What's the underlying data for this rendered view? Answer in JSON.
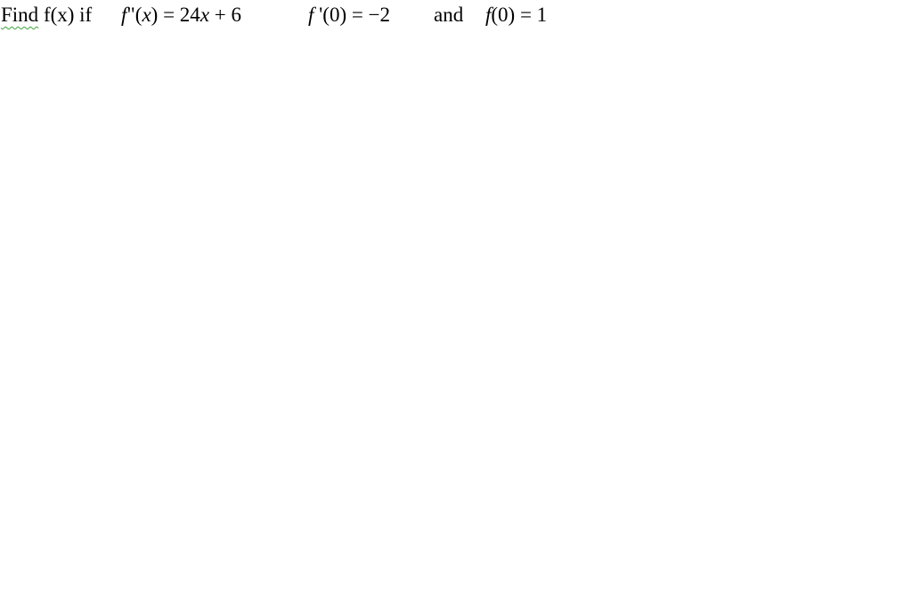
{
  "document": {
    "prefix_word_find": "Find",
    "prefix_rest": " f(x) if",
    "equation_1": {
      "f": "f",
      "primes": "\"",
      "open": "(",
      "var": "x",
      "close_eq": ") = 24",
      "var2": "x",
      "tail": " + 6"
    },
    "equation_2": {
      "f": "f",
      "rest": " '(0) = −2"
    },
    "connector": "and",
    "equation_3": {
      "f": "f",
      "rest": "(0) = 1"
    },
    "spellcheck_color": "#3aa63a"
  }
}
